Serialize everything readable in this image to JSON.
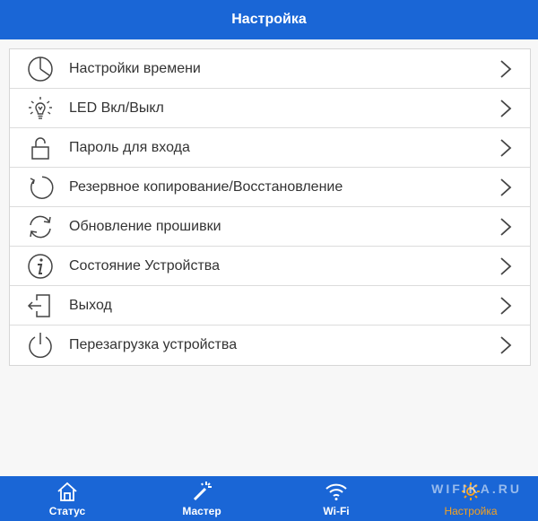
{
  "header": {
    "title": "Настройка"
  },
  "colors": {
    "brand": "#1a66d6",
    "active_tab": "#f7a21e"
  },
  "menu": [
    {
      "label": "Настройки времени",
      "icon": "clock-icon"
    },
    {
      "label": "LED Вкл/Выкл",
      "icon": "lightbulb-icon"
    },
    {
      "label": "Пароль для входа",
      "icon": "padlock-icon"
    },
    {
      "label": "Резервное копирование/Восстановление",
      "icon": "backup-restore-icon"
    },
    {
      "label": "Обновление прошивки",
      "icon": "refresh-icon"
    },
    {
      "label": "Состояние Устройства",
      "icon": "info-icon"
    },
    {
      "label": "Выход",
      "icon": "logout-icon"
    },
    {
      "label": "Перезагрузка устройства",
      "icon": "power-icon"
    }
  ],
  "tabs": [
    {
      "label": "Статус",
      "icon": "home-icon"
    },
    {
      "label": "Мастер",
      "icon": "magic-wand-icon"
    },
    {
      "label": "Wi-Fi",
      "icon": "wifi-icon"
    },
    {
      "label": "Настройка",
      "icon": "gear-icon",
      "active": true
    }
  ],
  "watermark": "WIFIKA.RU"
}
